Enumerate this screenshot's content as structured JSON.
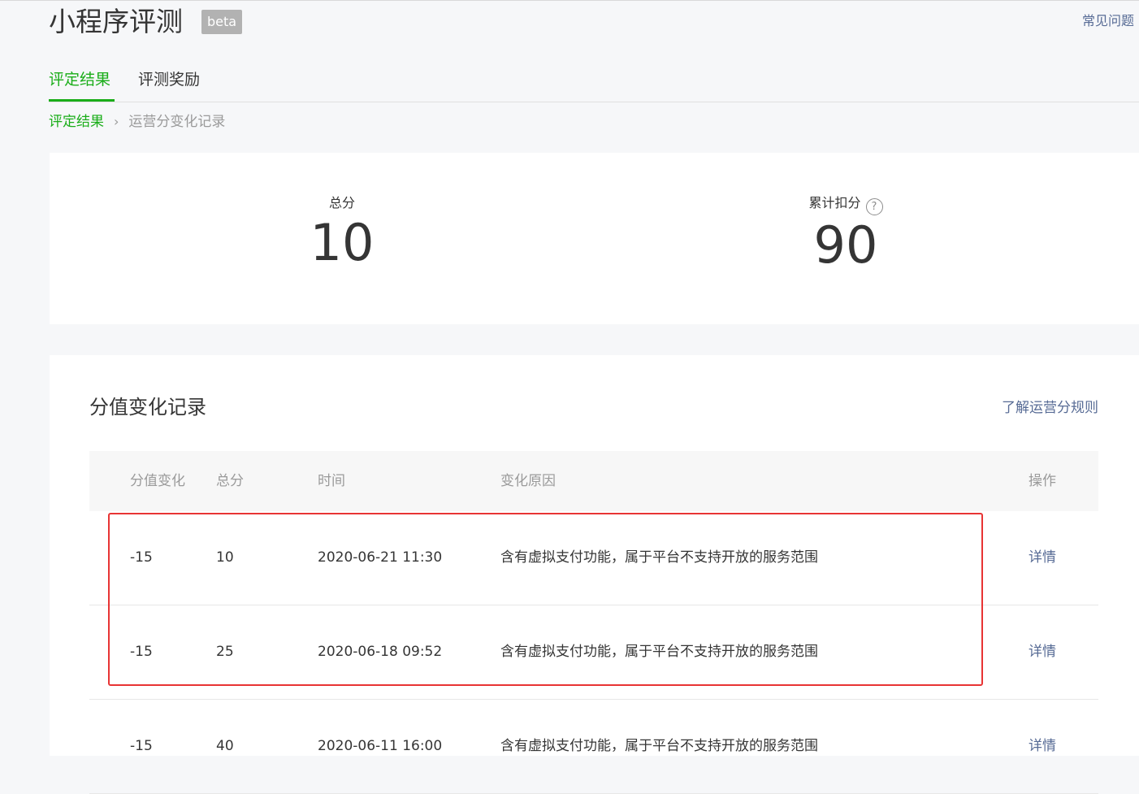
{
  "header": {
    "title": "小程序评测",
    "badge": "beta",
    "faq_link": "常见问题"
  },
  "tabs": [
    {
      "label": "评定结果",
      "active": true
    },
    {
      "label": "评测奖励",
      "active": false
    }
  ],
  "breadcrumb": {
    "parent": "评定结果",
    "separator": "›",
    "current": "运营分变化记录"
  },
  "summary": {
    "total_label": "总分",
    "total_value": "10",
    "deducted_label": "累计扣分",
    "deducted_value": "90",
    "help_icon": "?"
  },
  "records": {
    "title": "分值变化记录",
    "rules_link": "了解运营分规则",
    "columns": [
      "分值变化",
      "总分",
      "时间",
      "变化原因",
      "操作"
    ],
    "rows": [
      {
        "change": "-15",
        "total": "10",
        "time": "2020-06-21 11:30",
        "reason": "含有虚拟支付功能，属于平台不支持开放的服务范围",
        "action": "详情"
      },
      {
        "change": "-15",
        "total": "25",
        "time": "2020-06-18 09:52",
        "reason": "含有虚拟支付功能，属于平台不支持开放的服务范围",
        "action": "详情"
      },
      {
        "change": "-15",
        "total": "40",
        "time": "2020-06-11 16:00",
        "reason": "含有虚拟支付功能，属于平台不支持开放的服务范围",
        "action": "详情"
      }
    ]
  },
  "colors": {
    "accent_green": "#1aad19",
    "link_blue": "#576b95",
    "highlight_red": "#e83434"
  }
}
